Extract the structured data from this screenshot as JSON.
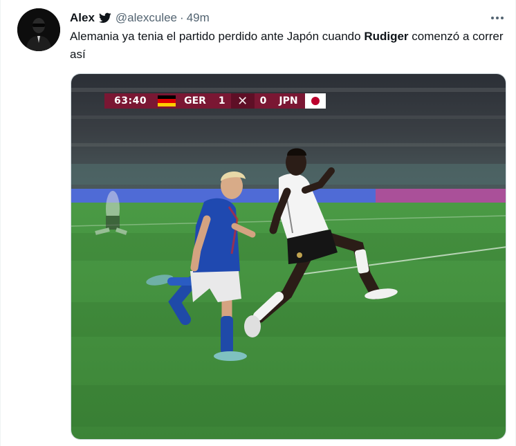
{
  "tweet": {
    "name": "Alex",
    "handle": "@alexculee",
    "separator": "·",
    "time": "49m",
    "text_before": "Alemania ya tenia el partido perdido ante Japón cuando ",
    "text_bold": "Rudiger",
    "text_after": " comenzó a correr así"
  },
  "icons": {
    "avatar": "profile-avatar",
    "verified_bird": "twitter-bird-icon",
    "more": "more-options-icon"
  },
  "media": {
    "scoreboard": {
      "clock": "63:40",
      "home_team": "GER",
      "home_score": "1",
      "away_score": "0",
      "away_team": "JPN"
    }
  },
  "colors": {
    "scoreboard_bg": "#7a1733",
    "secondary_text": "#536471",
    "pitch": "#3f8a3a"
  }
}
